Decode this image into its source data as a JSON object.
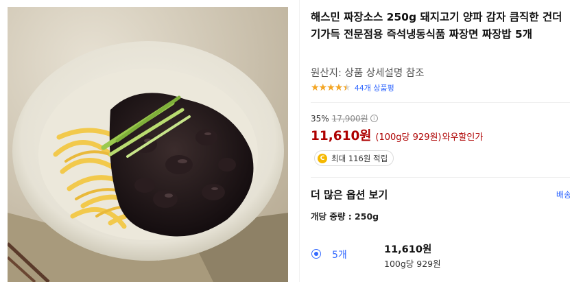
{
  "product": {
    "title": "해스민 짜장소스 250g 돼지고기 양파 감자 큼직한 건더기가득 전문점용 즉석냉동식품 짜장면 짜장밥 5개",
    "origin": "원산지: 상품 상세설명 참조",
    "rating_fraction": 0.9,
    "stars": "★★★★★",
    "review_count": "44개 상품평"
  },
  "price": {
    "discount": "35%",
    "original": "17,900원",
    "info_icon": "i",
    "sale": "11,610원",
    "unit": "(100g당 929원)",
    "wow_label": "와우할인가"
  },
  "reward": {
    "coin_symbol": "C",
    "text": "최대 116원 적립"
  },
  "options": {
    "more_label": "더 많은 옵션 보기",
    "shipping_peek": "배송",
    "weight": "개당 중량 : 250g",
    "items": [
      {
        "label": "5개",
        "price": "11,610원",
        "unit": "100g당 929원",
        "selected": true
      }
    ]
  },
  "colors": {
    "accent_blue": "#346aff",
    "price_red": "#ae0000",
    "star_gold": "#f5a623"
  }
}
